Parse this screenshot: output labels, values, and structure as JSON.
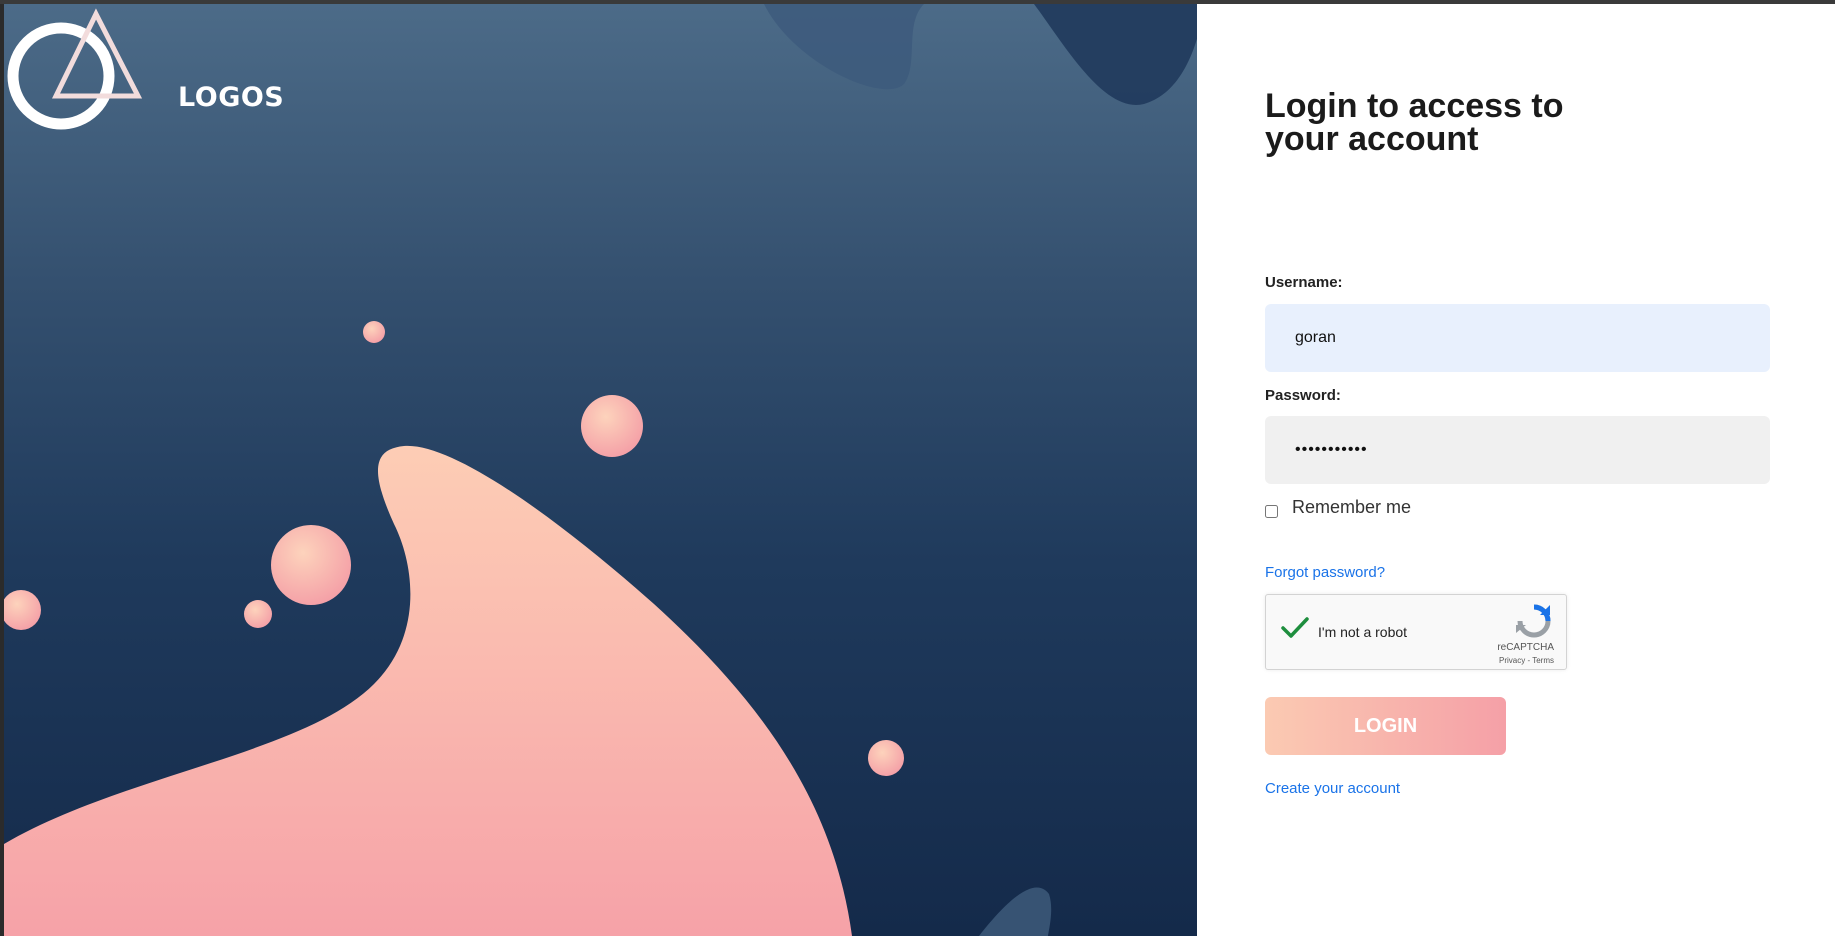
{
  "brand": {
    "logo_text": "LOGOS"
  },
  "form": {
    "heading": "Login to access to your account",
    "username_label": "Username:",
    "username_value": "goran",
    "password_label": "Password:",
    "password_value": "•••••••••••",
    "remember_label": "Remember me",
    "forgot_link": "Forgot password?",
    "login_button": "LOGIN",
    "create_link": "Create your account"
  },
  "captcha": {
    "label": "I'm not a robot",
    "brand": "reCAPTCHA",
    "links": "Privacy - Terms",
    "checked": true
  },
  "colors": {
    "accent_link": "#1a73e8",
    "button_gradient_start": "#fbcab2",
    "button_gradient_end": "#f5a0a7",
    "hero_dark": "#142a4a",
    "hero_light": "#4c6b88"
  }
}
